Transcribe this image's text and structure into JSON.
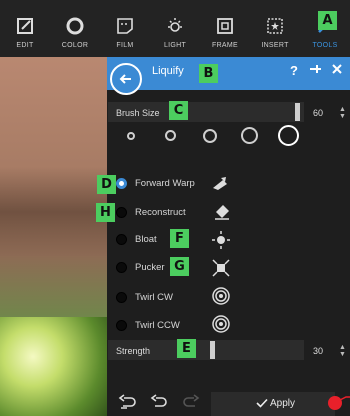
{
  "toolbar": {
    "items": [
      {
        "label": "EDIT",
        "icon": "edit-icon"
      },
      {
        "label": "COLOR",
        "icon": "color-icon"
      },
      {
        "label": "FILM",
        "icon": "film-icon"
      },
      {
        "label": "LIGHT",
        "icon": "light-icon"
      },
      {
        "label": "FRAME",
        "icon": "frame-icon"
      },
      {
        "label": "INSERT",
        "icon": "insert-icon"
      },
      {
        "label": "TOOLS",
        "icon": "tools-icon"
      }
    ],
    "active": "TOOLS",
    "active_color": "#3a93df"
  },
  "panel": {
    "title": "Liquify",
    "header_color": "#3b8ad4",
    "help_icon": "?",
    "pin_icon": "pin-icon",
    "close_icon": "close-icon"
  },
  "brush_size": {
    "label": "Brush Size",
    "value": "60",
    "level": 0.95
  },
  "brush_presets": [
    "preset-1",
    "preset-2",
    "preset-3",
    "preset-4",
    "preset-5"
  ],
  "modes": [
    {
      "label": "Forward Warp",
      "icon": "forward-warp-icon",
      "selected": true
    },
    {
      "label": "Reconstruct",
      "icon": "reconstruct-icon",
      "selected": false
    },
    {
      "label": "Bloat",
      "icon": "bloat-icon",
      "selected": false
    },
    {
      "label": "Pucker",
      "icon": "pucker-icon",
      "selected": false
    },
    {
      "label": "Twirl CW",
      "icon": "twirl-cw-icon",
      "selected": false
    },
    {
      "label": "Twirl CCW",
      "icon": "twirl-ccw-icon",
      "selected": false
    }
  ],
  "strength": {
    "label": "Strength",
    "value": "30",
    "level": 0.3
  },
  "footer": {
    "apply_label": "Apply"
  },
  "callouts": {
    "A": "A",
    "B": "B",
    "C": "C",
    "D": "D",
    "E": "E",
    "F": "F",
    "G": "G",
    "H": "H"
  },
  "callout_color": "#4ccd5f"
}
